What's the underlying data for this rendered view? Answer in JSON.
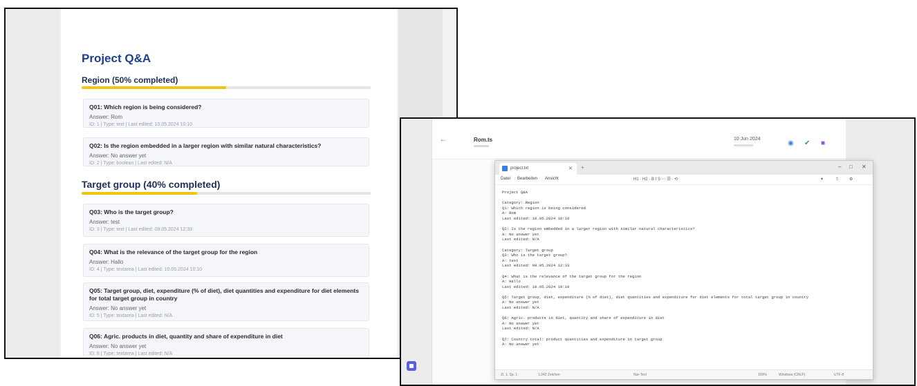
{
  "document": {
    "title": "Project Q&A",
    "categories": [
      {
        "title": "Region (50% completed)",
        "progress": 0.5,
        "questions": [
          {
            "question": "Q01: Which region is being considered?",
            "answer": "Answer: Rom",
            "meta": "ID: 1 | Type: text | Last edited: 10.05.2024 10:10"
          },
          {
            "question": "Q02: Is the region embedded in a larger region with similar natural characteristics?",
            "answer": "Answer: No answer yet",
            "meta": "ID: 2 | Type: boolean | Last edited: N/A"
          }
        ]
      },
      {
        "title": "Target group (40% completed)",
        "progress": 0.4,
        "questions": [
          {
            "question": "Q03: Who is the target group?",
            "answer": "Answer: test",
            "meta": "ID: 3 | Type: text | Last edited: 09.05.2024 12:33"
          },
          {
            "question": "Q04: What is the relevance of the target group for the region",
            "answer": "Answer: Hallo",
            "meta": "ID: 4 | Type: textarea | Last edited: 10.05.2024 10:10"
          },
          {
            "question": "Q05: Target group, diet, expenditure (% of diet), diet quantities and expenditure for diet elements for total target group in country",
            "answer": "Answer: No answer yet",
            "meta": "ID: 5 | Type: textarea | Last edited: N/A"
          },
          {
            "question": "Q06: Agric. products in diet, quantity and share of expenditure in diet",
            "answer": "Answer: No answer yet",
            "meta": "ID: 6 | Type: textarea | Last edited: N/A"
          }
        ]
      }
    ]
  },
  "mail": {
    "back_icon": "←",
    "sender": "Rom.ts",
    "date": "10 Jun 2024",
    "icons": [
      "reply-icon",
      "forward-icon",
      "bookmark-icon"
    ]
  },
  "notepad": {
    "tab_name": "project.txt",
    "menu": [
      "Datei",
      "Bearbeiten",
      "Ansicht"
    ],
    "toolbar": "H1  ·  H2  ·  B  I  S  ⋯  ☰  ·  ⟲",
    "lines": [
      "Project Q&A",
      "",
      "Category: Region",
      "Q1: Which region is being considered",
      "A: Rom",
      "Last edited: 10.05.2024 10:10",
      "",
      "Q2: Is the region embedded in a larger region with similar natural characteristics?",
      "A: No answer yet",
      "Last edited: N/A",
      "",
      "Category: Target group",
      "Q3: Who is the target group?",
      "A: test",
      "Last edited: 09.05.2024 12:33",
      "",
      "Q4: What is the relevance of the target group for the region",
      "A: Hallo",
      "Last edited: 10.05.2024 10:10",
      "",
      "Q5: Target group, diet, expenditure (% of diet), diet quantities and expenditure for diet elements for total target group in country",
      "A: No answer yet",
      "Last edited: N/A",
      "",
      "Q6: Agric. products in diet, quantity and share of expenditure in diet",
      "A: No answer yet",
      "Last edited: N/A",
      "",
      "Q7: Country total: product quantities and expenditure in target group",
      "A: No answer yet"
    ],
    "status": [
      "Zl. 1, Sp. 1",
      "1.042 Zeichen",
      "Nur-Text",
      "100%",
      "Windows (CRLF)",
      "UTF-8"
    ]
  }
}
